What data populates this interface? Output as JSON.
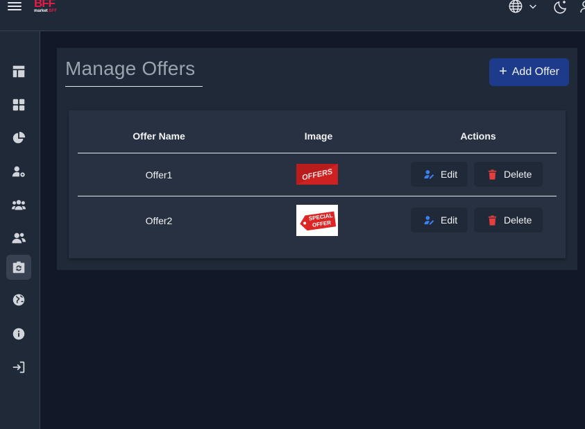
{
  "brand": {
    "logo_big": "BFF",
    "logo_small_a": "market",
    "logo_small_b": "BFF"
  },
  "colors": {
    "accent": "#1e3a8a",
    "danger": "#e53e3e",
    "edit_icon": "#3b82f6",
    "brand": "#e11d48"
  },
  "topbar": {
    "icons": [
      "menu-icon",
      "globe-icon",
      "chevron-down-icon",
      "moon-icon",
      "user-icon"
    ]
  },
  "sidebar": {
    "items": [
      {
        "icon": "layout-icon",
        "active": false
      },
      {
        "icon": "grid-icon",
        "active": false
      },
      {
        "icon": "pie-chart-icon",
        "active": false
      },
      {
        "icon": "user-settings-icon",
        "active": false
      },
      {
        "icon": "group-icon",
        "active": false
      },
      {
        "icon": "users-icon",
        "active": false
      },
      {
        "icon": "refresh-bag-icon",
        "active": true
      },
      {
        "icon": "globe-icon",
        "active": false
      },
      {
        "icon": "info-icon",
        "active": false
      },
      {
        "icon": "logout-icon",
        "active": false
      }
    ]
  },
  "page": {
    "title": "Manage Offers",
    "add_button": "Add Offer"
  },
  "table": {
    "headers": [
      "Offer Name",
      "Image",
      "Actions"
    ],
    "rows": [
      {
        "name": "Offer1",
        "image_text": "OFFERS",
        "edit": "Edit",
        "delete": "Delete"
      },
      {
        "name": "Offer2",
        "image_text_1": "SPECIAL",
        "image_text_2": "OFFER",
        "edit": "Edit",
        "delete": "Delete"
      }
    ]
  }
}
